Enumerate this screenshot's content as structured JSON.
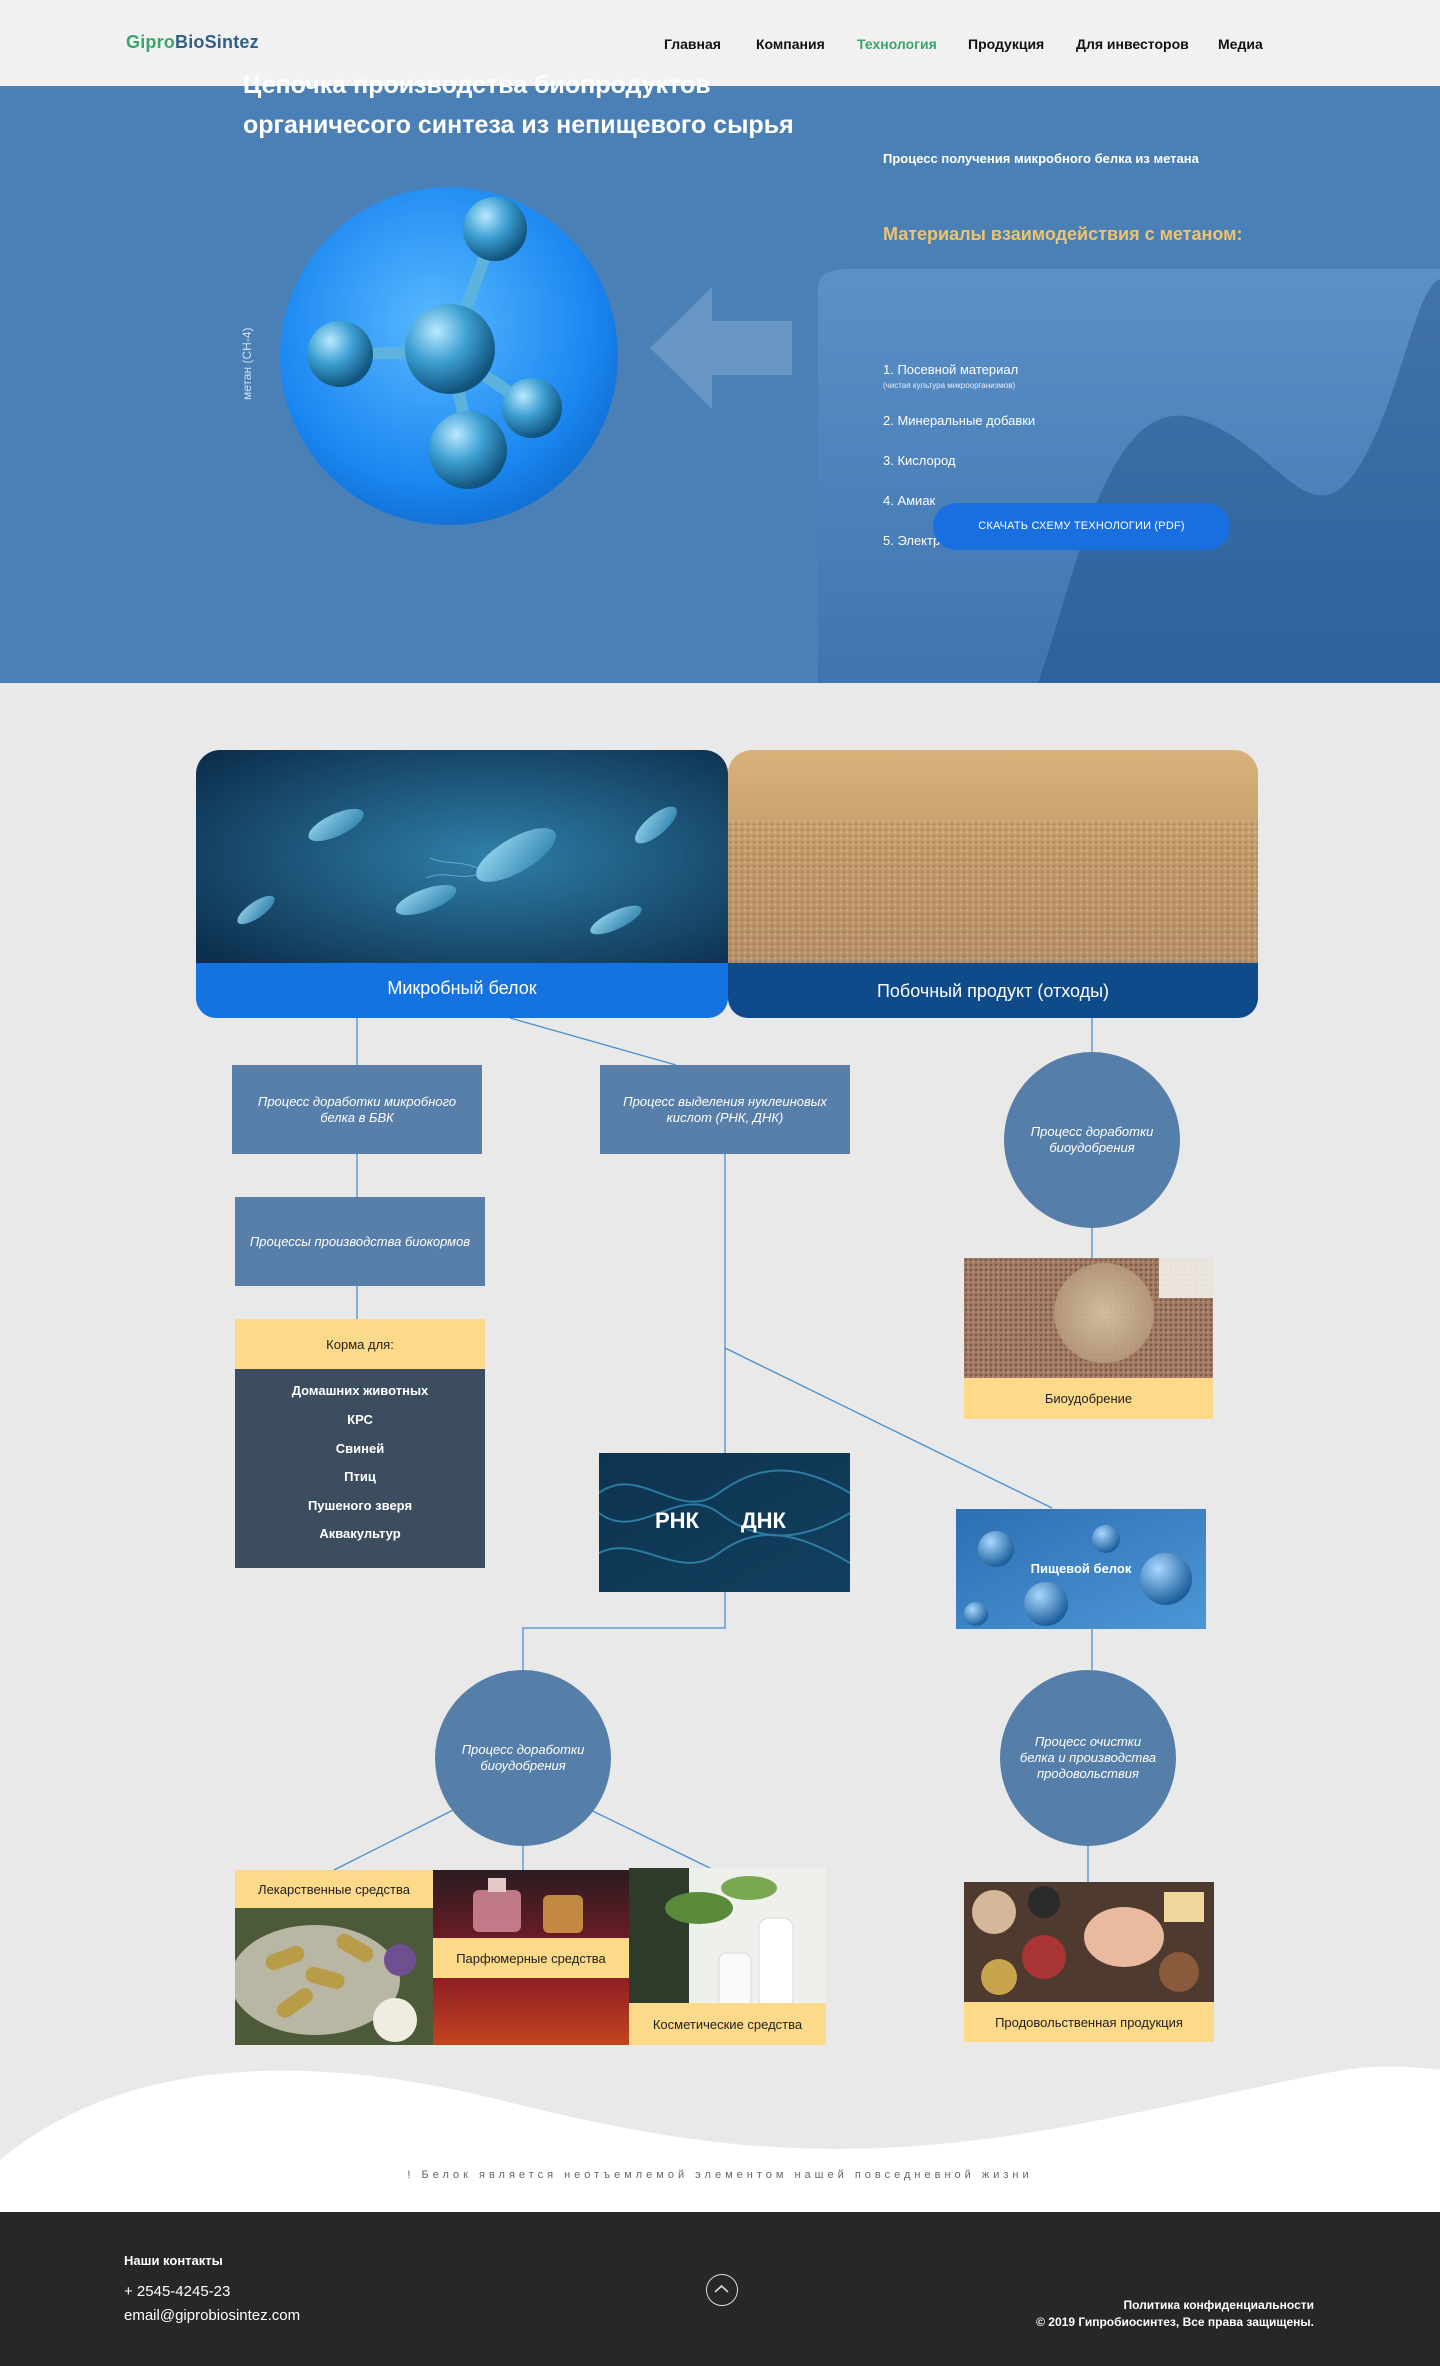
{
  "brand": {
    "part1": "Gipro",
    "part2": "BioSintez"
  },
  "nav": [
    "Главная",
    "Компания",
    "Технология",
    "Продукция",
    "Для инвесторов",
    "Медиа"
  ],
  "active_nav": "Технология",
  "hero": {
    "title_line1": "Цепочка производства биопродуктов",
    "title_line2": "органичесого синтеза из непищевого сырья",
    "caption": "Процесс получения микробного белка из метана",
    "methane_label": "метан (СН-4)",
    "panel_title": "Материалы взаимодействия с метаном:",
    "materials": [
      "1. Посевной материал",
      "2. Минеральные добавки",
      "3. Кислород",
      "4. Амиак",
      "5. Электроэнергия"
    ],
    "material1_note": "(чистая культура микроорганизмов)",
    "download_button": "СКАЧАТЬ СХЕМУ ТЕХНОЛОГИИ (PDF)"
  },
  "flow": {
    "microbial_protein": "Микробный белок",
    "byproduct": "Побочный продукт (отходы)",
    "box_bvk": "Процесс доработки микробного белка в БВК",
    "box_nucleic": "Процесс выделения нуклеиновых кислот (РНК, ДНК)",
    "box_biofeed": "Процессы производства биокормов",
    "circle_biofert": "Процесс доработки биоудобрения",
    "feed_header": "Корма для:",
    "feeds": [
      "Домашних животных",
      "КРС",
      "Свиней",
      "Птиц",
      "Пушеного зверя",
      "Аквакультур"
    ],
    "biofertilizer": "Биоудобрение",
    "rna": "РНК",
    "dna": "ДНК",
    "food_protein": "Пищевой белок",
    "circle_biofert2": "Процесс доработки биоудобрения",
    "circle_cleaning": "Процесс очистки белка и производства продовольствия",
    "medicines": "Лекарственные средства",
    "perfumes": "Парфюмерные средства",
    "cosmetics": "Косметические средства",
    "food_products": "Продовольственная продукция"
  },
  "slogan": "!  Белок является неотъемлемой элементом нашей повседневной жизни",
  "footer": {
    "contacts_title": "Наши контакты",
    "phone": "+ 2545-4245-23",
    "email": "email@giprobiosintez.com",
    "privacy": "Политика конфиденциальности",
    "copyright": "© 2019 Гипробиосинтез, Все права защищены."
  },
  "colors": {
    "accent_green": "#3aa56a",
    "hero_blue": "#4a80b6",
    "button_blue": "#1a6fe0",
    "label_yellow": "#fdd98a",
    "box_blue": "#577fa9"
  }
}
